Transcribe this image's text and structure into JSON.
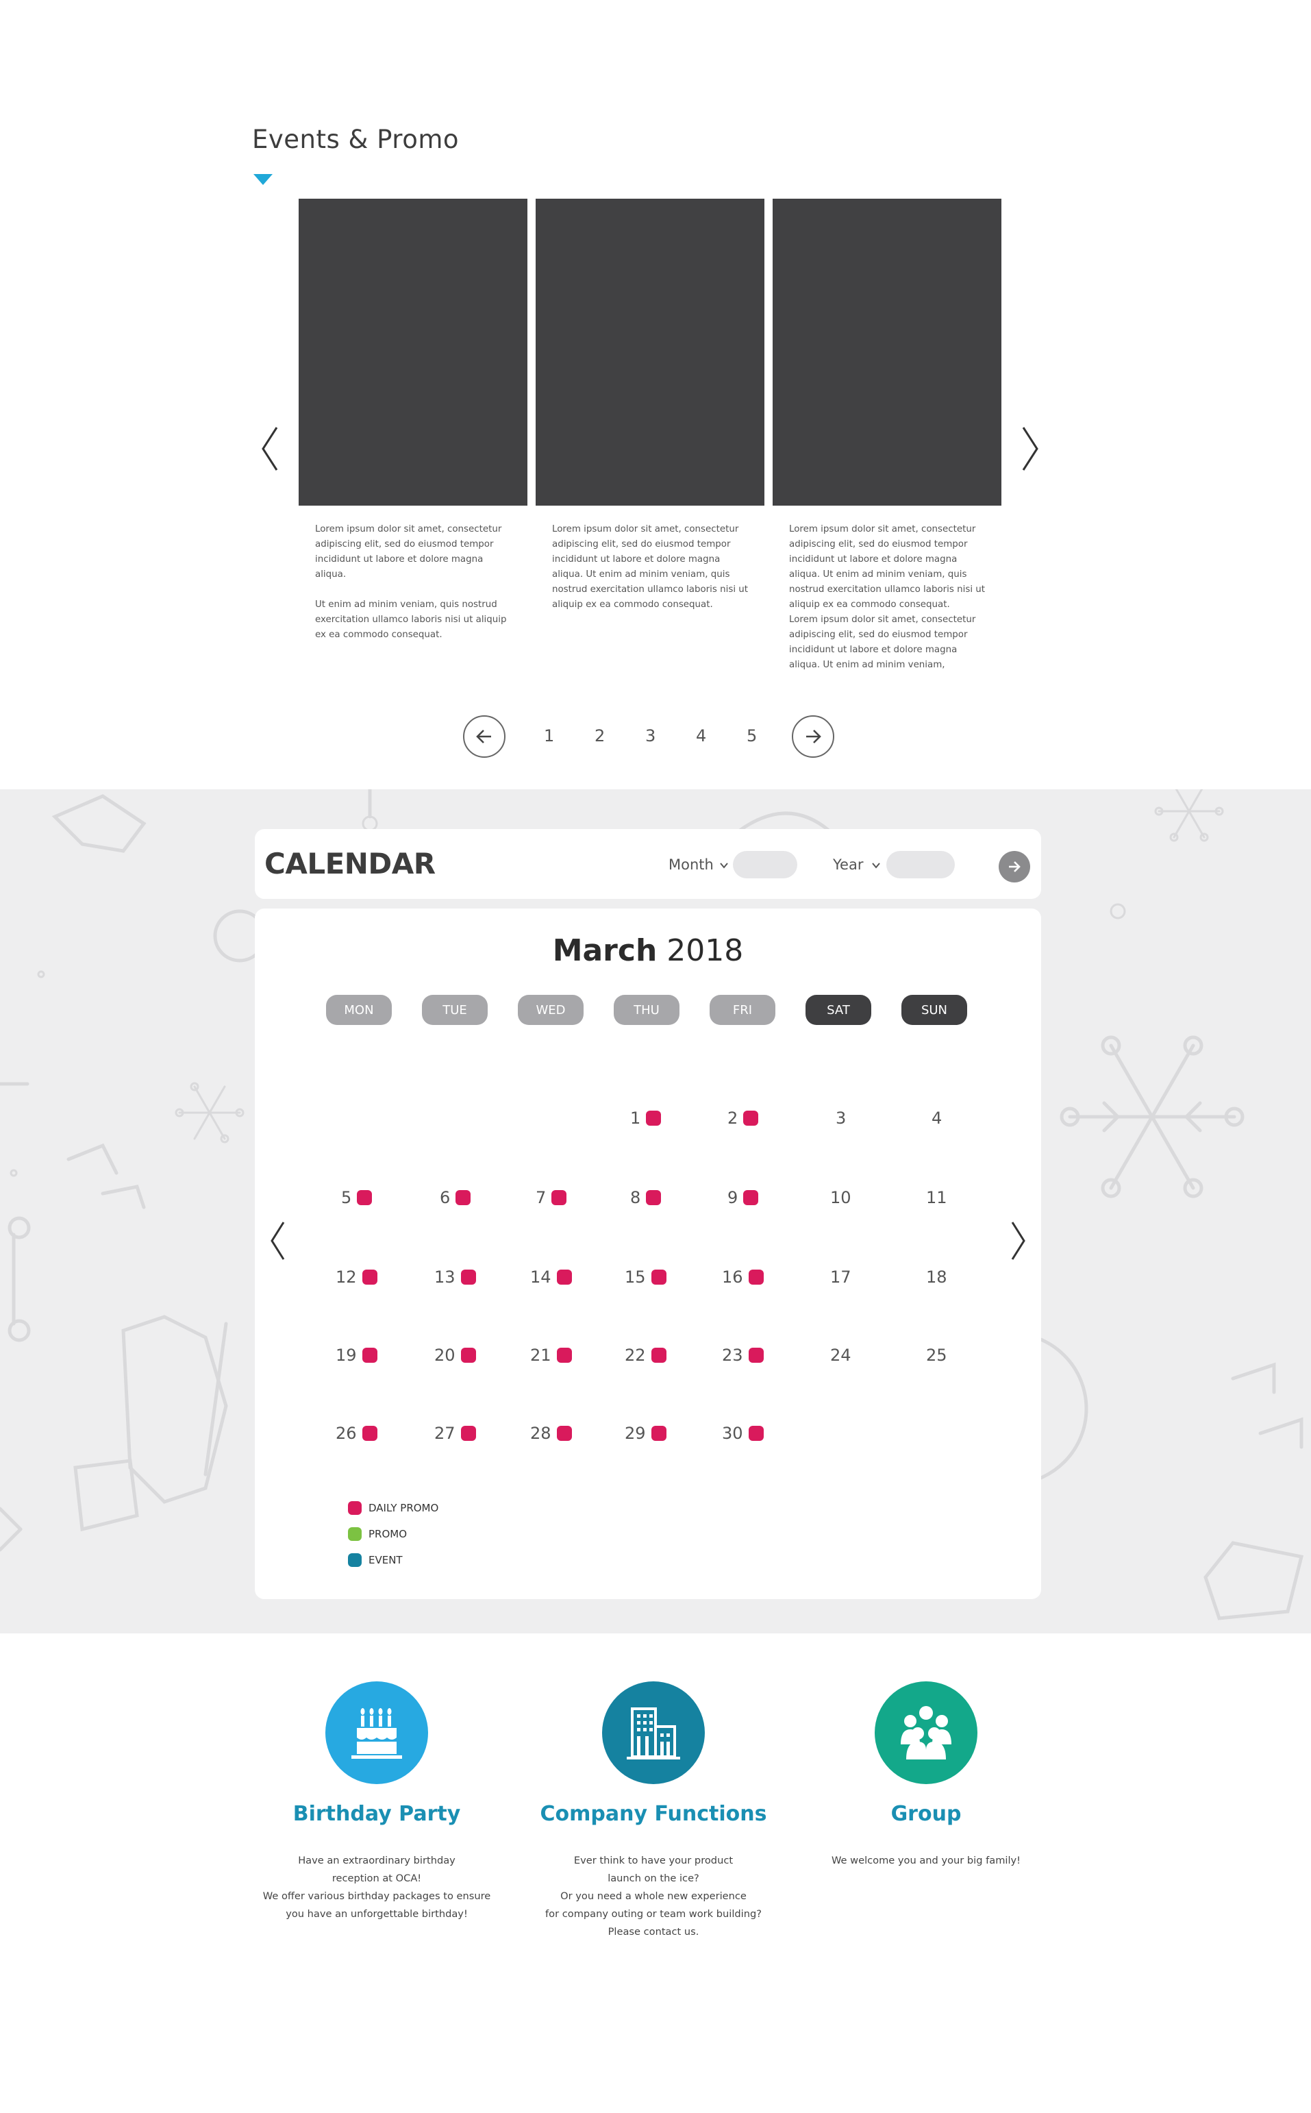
{
  "events": {
    "title": "Events & Promo",
    "cards": [
      {
        "text": "Lorem ipsum dolor sit amet, consectetur\nadipiscing elit, sed do eiusmod tempor\nincididunt ut labore et dolore magna\naliqua.\n\nUt enim ad minim veniam, quis nostrud\nexercitation ullamco laboris nisi ut aliquip\nex ea commodo consequat."
      },
      {
        "text": "Lorem ipsum dolor sit amet, consectetur\nadipiscing elit, sed do eiusmod tempor\nincididunt ut labore et dolore magna\naliqua. Ut enim ad minim veniam, quis\nnostrud exercitation ullamco laboris nisi ut\naliquip ex ea commodo consequat."
      },
      {
        "text": "Lorem ipsum dolor sit amet, consectetur\nadipiscing elit, sed do eiusmod tempor\nincididunt ut labore et dolore magna\naliqua. Ut enim ad minim veniam, quis\nnostrud exercitation ullamco laboris nisi ut\naliquip ex ea commodo consequat.\nLorem ipsum dolor sit amet, consectetur\nadipiscing elit, sed do eiusmod tempor\nincididunt ut labore et dolore magna\naliqua. Ut enim ad minim veniam,"
      }
    ],
    "pagination": [
      "1",
      "2",
      "3",
      "4",
      "5"
    ]
  },
  "calendar": {
    "title": "CALENDAR",
    "month_label": "Month",
    "year_label": "Year",
    "month_name": "March",
    "year": "2018",
    "weekdays": [
      "MON",
      "TUE",
      "WED",
      "THU",
      "FRI",
      "SAT",
      "SUN"
    ],
    "weeks": [
      [
        null,
        null,
        null,
        {
          "day": "1",
          "dot": true
        },
        {
          "day": "2",
          "dot": true
        },
        {
          "day": "3",
          "dot": false
        },
        {
          "day": "4",
          "dot": false
        }
      ],
      [
        {
          "day": "5",
          "dot": true
        },
        {
          "day": "6",
          "dot": true
        },
        {
          "day": "7",
          "dot": true
        },
        {
          "day": "8",
          "dot": true
        },
        {
          "day": "9",
          "dot": true
        },
        {
          "day": "10",
          "dot": false
        },
        {
          "day": "11",
          "dot": false
        }
      ],
      [
        {
          "day": "12",
          "dot": true
        },
        {
          "day": "13",
          "dot": true
        },
        {
          "day": "14",
          "dot": true
        },
        {
          "day": "15",
          "dot": true
        },
        {
          "day": "16",
          "dot": true
        },
        {
          "day": "17",
          "dot": false
        },
        {
          "day": "18",
          "dot": false
        }
      ],
      [
        {
          "day": "19",
          "dot": true
        },
        {
          "day": "20",
          "dot": true
        },
        {
          "day": "21",
          "dot": true
        },
        {
          "day": "22",
          "dot": true
        },
        {
          "day": "23",
          "dot": true
        },
        {
          "day": "24",
          "dot": false
        },
        {
          "day": "25",
          "dot": false
        }
      ],
      [
        {
          "day": "26",
          "dot": true
        },
        {
          "day": "27",
          "dot": true
        },
        {
          "day": "28",
          "dot": true
        },
        {
          "day": "29",
          "dot": true
        },
        {
          "day": "30",
          "dot": true
        },
        null,
        null
      ]
    ],
    "legend": [
      {
        "label": "DAILY PROMO",
        "color": "#d91a5c"
      },
      {
        "label": "PROMO",
        "color": "#7cc242"
      },
      {
        "label": "EVENT",
        "color": "#1582a0"
      }
    ],
    "dot_color": "#d91a5c"
  },
  "services": [
    {
      "icon": "birthday-cake-icon",
      "color": "#27a9e1",
      "title": "Birthday Party",
      "desc": "Have an extraordinary birthday\nreception at OCA!\nWe offer various birthday packages to ensure\nyou have an unforgettable birthday!"
    },
    {
      "icon": "office-building-icon",
      "color": "#1582a0",
      "title": "Company Functions",
      "desc": "Ever think to have your product\nlaunch on the ice?\nOr you need a whole new experience\nfor company outing or team work building?\nPlease contact us."
    },
    {
      "icon": "group-people-icon",
      "color": "#13a88a",
      "title": "Group",
      "desc": "We welcome you and your big family!"
    }
  ]
}
